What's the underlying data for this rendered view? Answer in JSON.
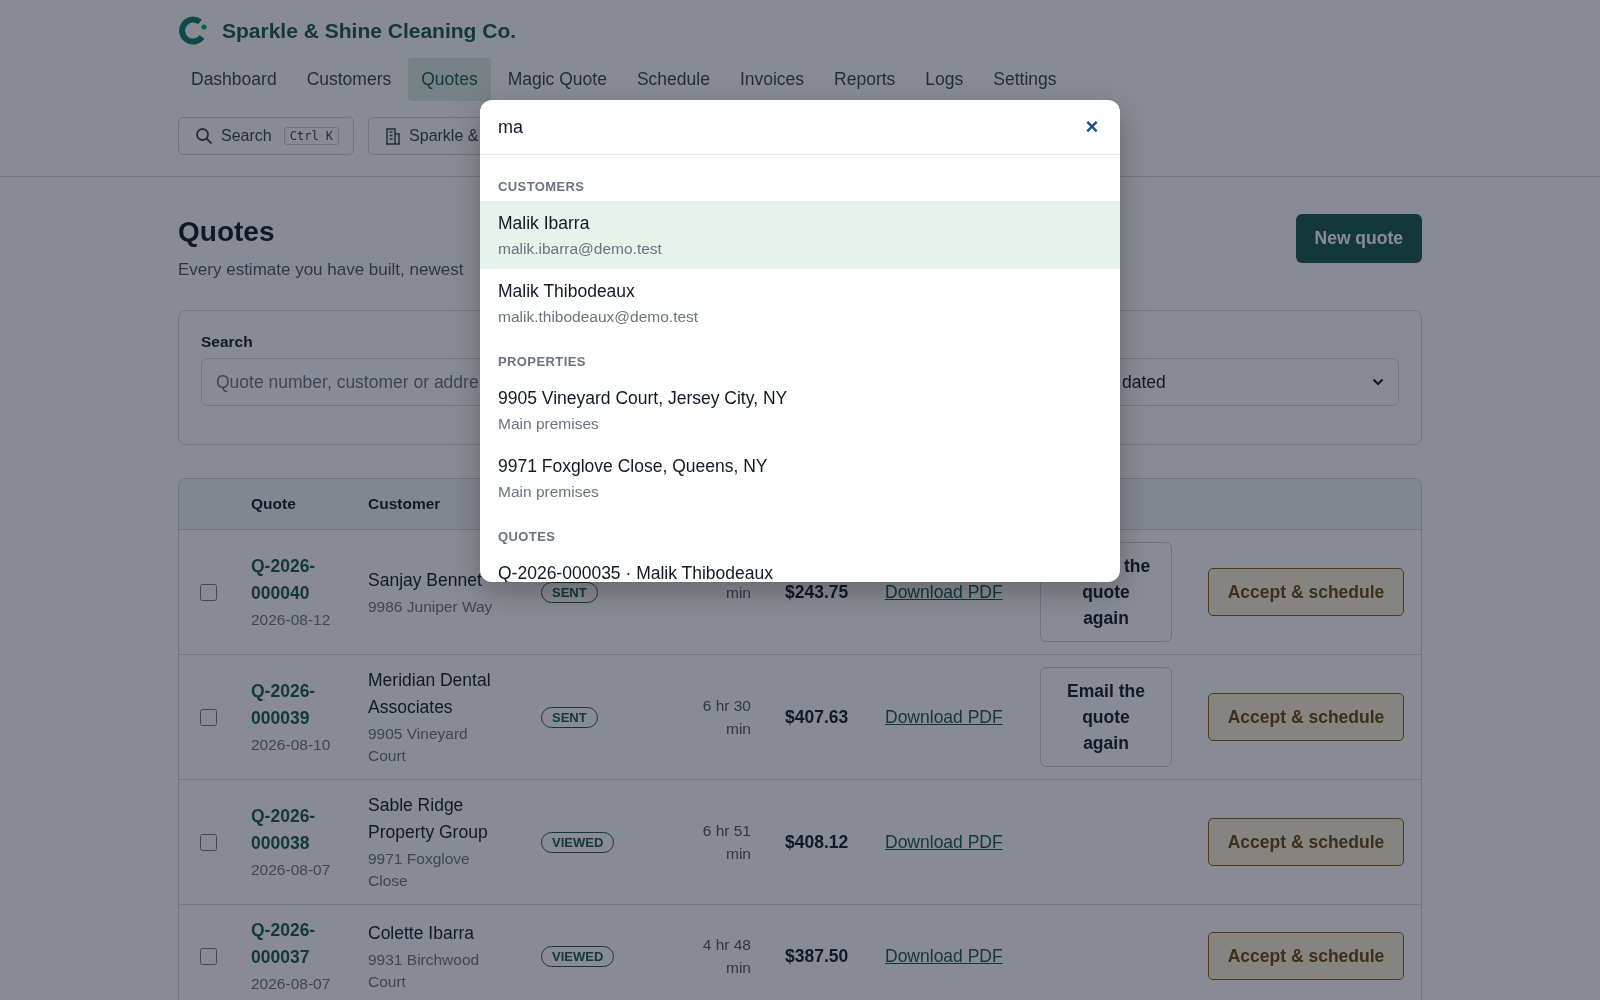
{
  "brand": {
    "name": "Sparkle & Shine Cleaning Co."
  },
  "nav": [
    {
      "label": "Dashboard",
      "selected": false
    },
    {
      "label": "Customers",
      "selected": false
    },
    {
      "label": "Quotes",
      "selected": true
    },
    {
      "label": "Magic Quote",
      "selected": false
    },
    {
      "label": "Schedule",
      "selected": false
    },
    {
      "label": "Invoices",
      "selected": false
    },
    {
      "label": "Reports",
      "selected": false
    },
    {
      "label": "Logs",
      "selected": false
    },
    {
      "label": "Settings",
      "selected": false
    }
  ],
  "toolbar": {
    "search": {
      "label": "Search",
      "shortcut": "Ctrl K"
    },
    "organization": {
      "label": "Sparkle &"
    }
  },
  "page": {
    "title": "Quotes",
    "subtitle": "Every estimate you have built, newest",
    "new_button": "New quote"
  },
  "filters": {
    "search_label": "Search",
    "search_placeholder": "Quote number, customer or addre",
    "sort_value": "dated"
  },
  "table": {
    "columns": [
      "Quote",
      "Customer"
    ],
    "rows": [
      {
        "checked": false,
        "quote": "Q-2026-000040",
        "date": "2026-08-12",
        "customer": "Sanjay Bennet",
        "address": "9986 Juniper Way",
        "status": "SENT",
        "duration": "min",
        "amount": "$243.75",
        "link": "Download PDF",
        "email_button": "the quote again",
        "accept_button": "Accept & schedule"
      },
      {
        "checked": false,
        "quote": "Q-2026-000039",
        "date": "2026-08-10",
        "customer": "Meridian Dental Associates",
        "address": "9905 Vineyard Court",
        "status": "SENT",
        "duration": "6 hr 30 min",
        "amount": "$407.63",
        "link": "Download PDF",
        "email_button": "Email the quote again",
        "accept_button": "Accept & schedule"
      },
      {
        "checked": false,
        "quote": "Q-2026-000038",
        "date": "2026-08-07",
        "customer": "Sable Ridge Property Group",
        "address": "9971 Foxglove Close",
        "status": "VIEWED",
        "duration": "6 hr 51 min",
        "amount": "$408.12",
        "link": "Download PDF",
        "accept_button": "Accept & schedule"
      },
      {
        "checked": false,
        "quote": "Q-2026-000037",
        "date": "2026-08-07",
        "customer": "Colette Ibarra",
        "address": "9931 Birchwood Court",
        "status": "VIEWED",
        "duration": "4 hr 48 min",
        "amount": "$387.50",
        "link": "Download PDF",
        "accept_button": "Accept & schedule"
      }
    ]
  },
  "search_dialog": {
    "query": "ma",
    "close": "×",
    "sections": [
      {
        "title": "CUSTOMERS",
        "items": [
          {
            "title": "Malik Ibarra",
            "subtitle": "malik.ibarra@demo.test",
            "selected": true
          },
          {
            "title": "Malik Thibodeaux",
            "subtitle": "malik.thibodeaux@demo.test",
            "selected": false
          }
        ]
      },
      {
        "title": "PROPERTIES",
        "items": [
          {
            "title": "9905 Vineyard Court, Jersey City, NY",
            "subtitle": "Main premises",
            "selected": false
          },
          {
            "title": "9971 Foxglove Close, Queens, NY",
            "subtitle": "Main premises",
            "selected": false
          }
        ]
      },
      {
        "title": "QUOTES",
        "items": [
          {
            "title": "Q-2026-000035 · Malik Thibodeaux",
            "selected": false
          }
        ]
      }
    ]
  }
}
